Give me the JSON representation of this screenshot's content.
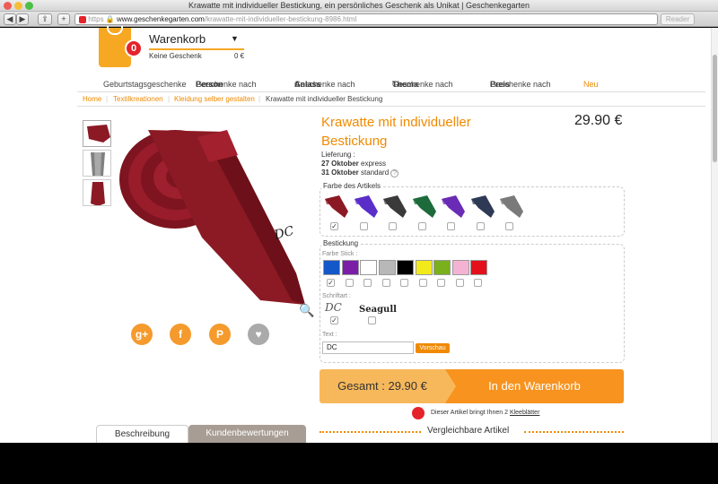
{
  "window": {
    "title": "Krawatte mit individueller Bestickung, ein persönliches Geschenk als Unikat | Geschenkegarten"
  },
  "toolbar": {
    "https": "https",
    "domain": "www.geschenkegarten.com",
    "path": "/krawatte-mit-individueller-bestickung-8986.html",
    "reader": "Reader",
    "plus": "+"
  },
  "cart": {
    "badge": "0",
    "title": "Warenkorb",
    "caret": "▼",
    "empty": "Keine Geschenk",
    "sum": "0 €"
  },
  "nav": {
    "items": [
      {
        "pre": "Geburtstagsgeschenke",
        "bold": ""
      },
      {
        "pre": "Geschenke nach ",
        "bold": "Person"
      },
      {
        "pre": "Geschenke nach ",
        "bold": "Anlass"
      },
      {
        "pre": "Geschenke nach ",
        "bold": "Thema"
      },
      {
        "pre": "Geschenke nach ",
        "bold": "Preis"
      },
      {
        "pre": "Neu",
        "bold": ""
      }
    ]
  },
  "breadcrumb": {
    "items": [
      "Home",
      "Textilkreationen",
      "Kleidung selber gestalten",
      "Krawatte mit individueller Bestickung"
    ]
  },
  "product": {
    "title": "Krawatte mit individueller Bestickung",
    "price": "29.90 €",
    "lieferung_label": "Lieferung :",
    "express_date": "27 Oktober",
    "express": "express",
    "standard_date": "31 Oktober",
    "standard": "standard",
    "embroidery_text": "DC"
  },
  "farbe_artikel": {
    "legend": "Farbe des Artikels",
    "colors": [
      "#8b1a24",
      "#5a2ec9",
      "#3a3a3a",
      "#1d6b3a",
      "#6a2bb5",
      "#2e3a55",
      "#7a7a7a"
    ],
    "selected": 0
  },
  "bestickung": {
    "legend": "Bestickung",
    "farbe_stick_label": "Farbe Stick :",
    "colors": [
      "#1457c8",
      "#7a1ea8",
      "#ffffff",
      "#b8b8b8",
      "#000000",
      "#f2ea1a",
      "#79b01c",
      "#f5b3d3",
      "#e3101c"
    ],
    "selected": 0,
    "schriftart_label": "Schriftart :",
    "font1": "DC",
    "font2": "Seagull",
    "text_label": "Text :",
    "text_value": "DC",
    "preview": "Vorschau"
  },
  "buy": {
    "gesamt": "Gesamt : 29.90 €",
    "add": "In den Warenkorb"
  },
  "klee": {
    "text": "Dieser Artikel bringt Ihnen 2 ",
    "link": "Kleeblätter"
  },
  "tabs": {
    "beschreibung": "Beschreibung",
    "kunden": "Kundenbewertungen",
    "vergleichbare": "Vergleichbare Artikel"
  },
  "social": {
    "gplus": "g+",
    "facebook": "f",
    "pinterest": "P",
    "heart": "♥"
  }
}
